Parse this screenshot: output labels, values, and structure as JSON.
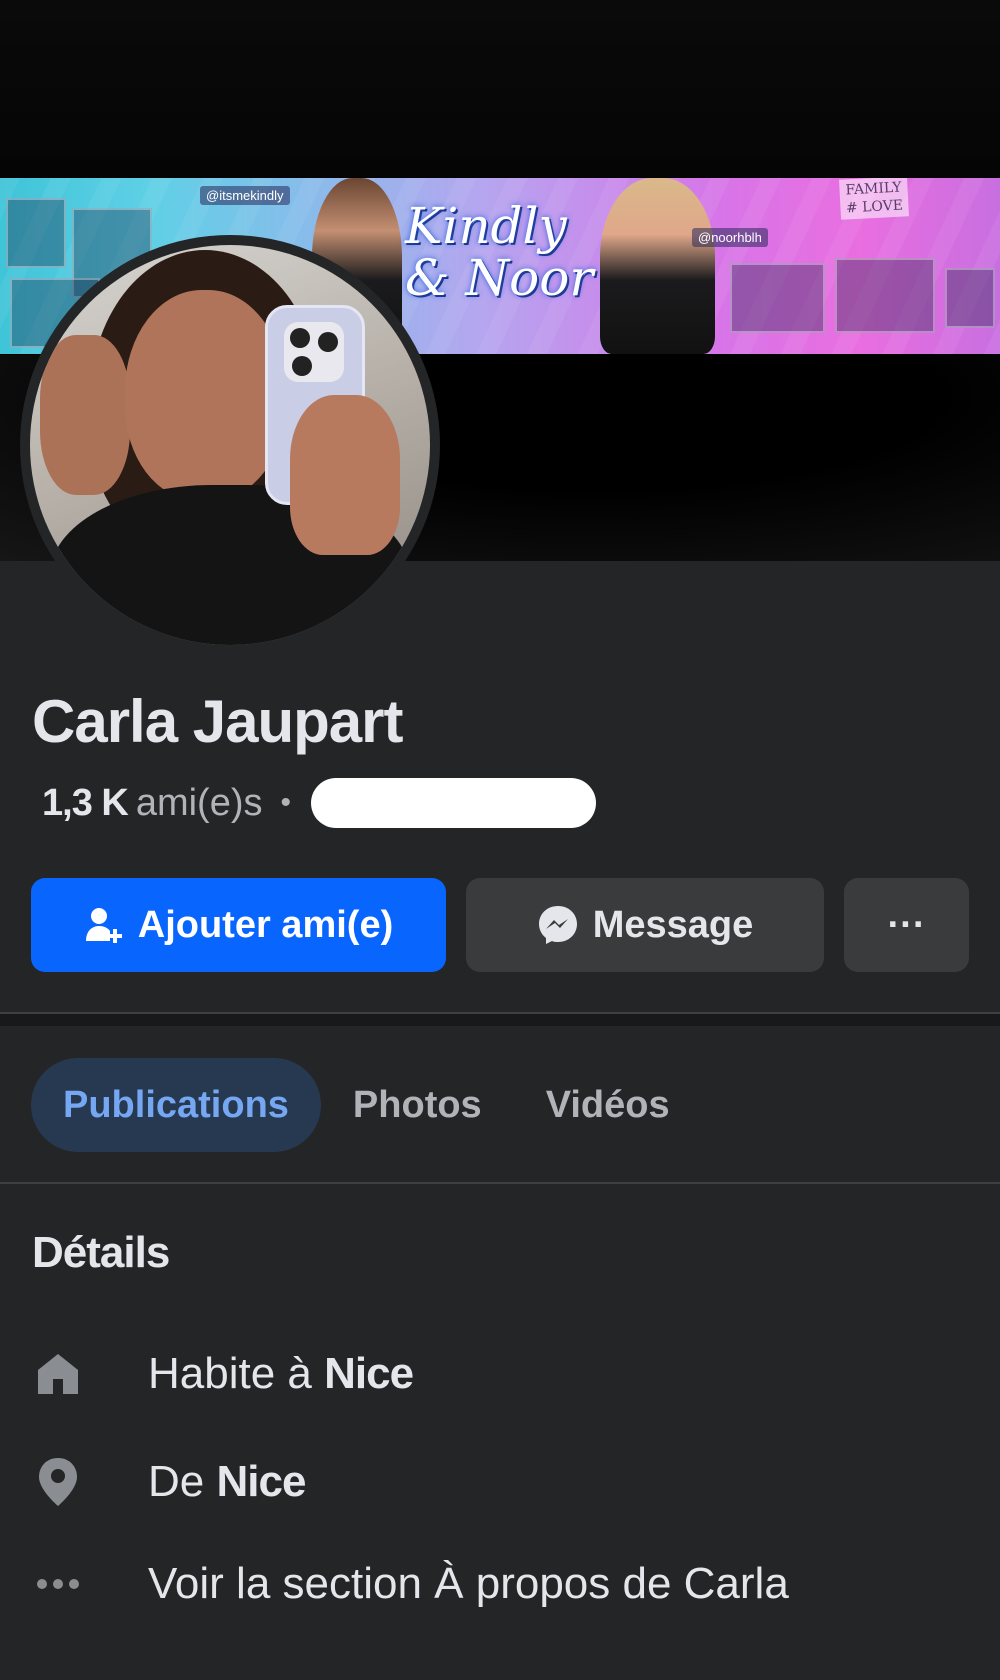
{
  "cover": {
    "banner_title_line1": "Kindly",
    "banner_title_line2": "& Noor",
    "tag_left": "@itsmekindly",
    "tag_right": "@noorhblh",
    "words": "FAMILY # LOVE"
  },
  "profile": {
    "name": "Carla Jaupart",
    "friends_count": "1,3 K",
    "friends_label": "ami(e)s",
    "separator": "•"
  },
  "actions": {
    "add_friend_label": "Ajouter ami(e)",
    "message_label": "Message",
    "more_label": "···"
  },
  "tabs": [
    {
      "label": "Publications",
      "active": true
    },
    {
      "label": "Photos",
      "active": false
    },
    {
      "label": "Vidéos",
      "active": false
    }
  ],
  "details": {
    "title": "Détails",
    "lives_prefix": "Habite à",
    "lives_city": "Nice",
    "from_prefix": "De",
    "from_city": "Nice",
    "about_link": "Voir la section À propos de Carla"
  },
  "icons": {
    "add_friend": "add-person-icon",
    "message": "messenger-icon",
    "more": "more-dots-icon",
    "home": "home-icon",
    "location": "location-pin-icon",
    "about": "more-dots-icon"
  },
  "colors": {
    "background": "#242526",
    "primary_button": "#0866ff",
    "secondary_button": "#3a3b3c",
    "active_tab_bg": "#263951",
    "active_tab_text": "#75a7f2",
    "text": "#e4e6eb",
    "muted": "#b0b3b8"
  }
}
